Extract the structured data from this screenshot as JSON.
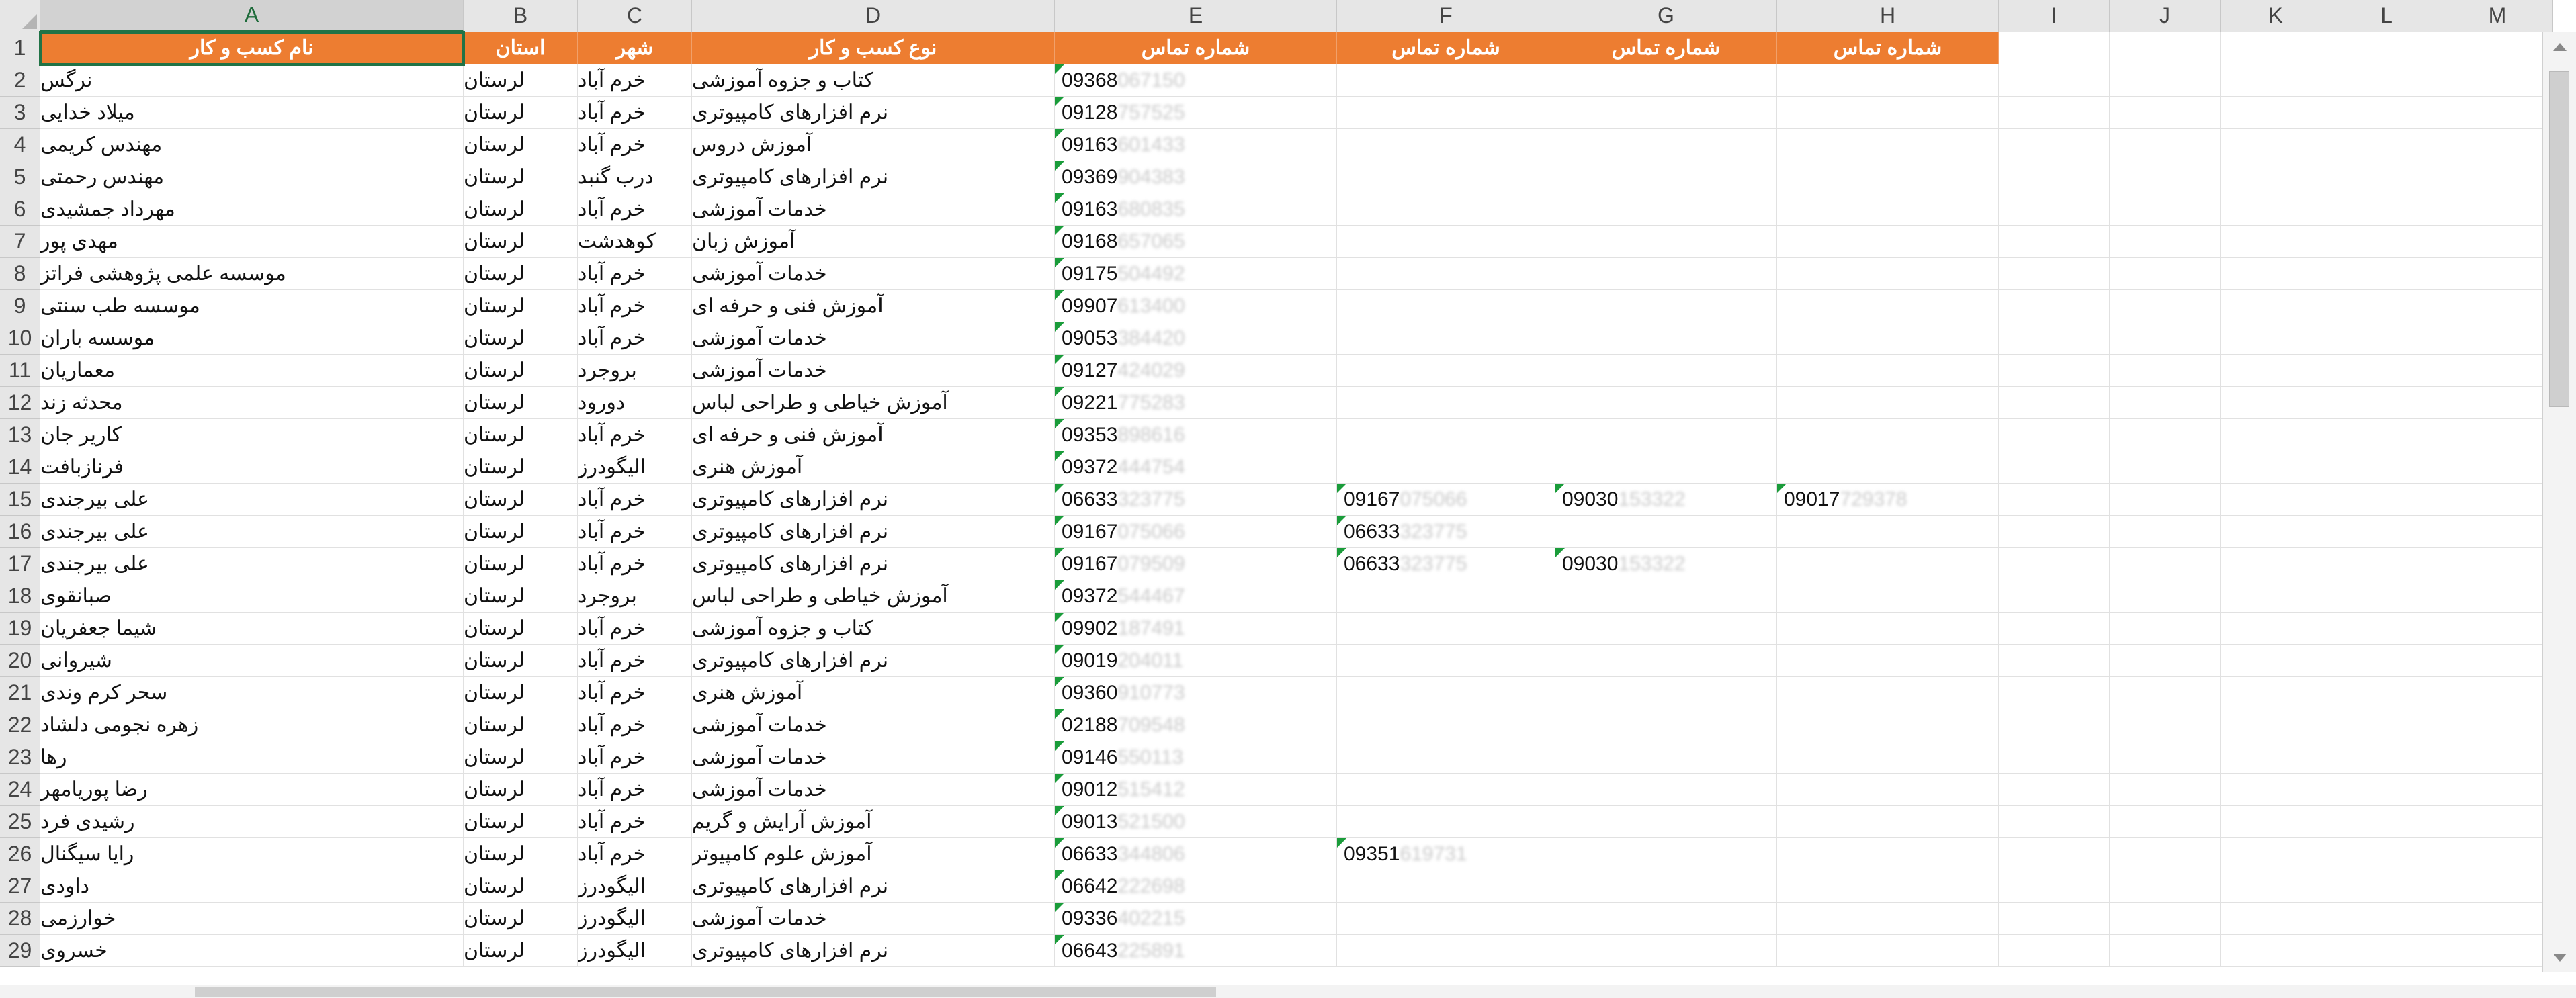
{
  "spreadsheet": {
    "selected_column": "A",
    "selected_row": "1",
    "columns": [
      {
        "letter": "A"
      },
      {
        "letter": "B"
      },
      {
        "letter": "C"
      },
      {
        "letter": "D"
      },
      {
        "letter": "E"
      },
      {
        "letter": "F"
      },
      {
        "letter": "G"
      },
      {
        "letter": "H"
      },
      {
        "letter": "I"
      },
      {
        "letter": "J"
      },
      {
        "letter": "K"
      },
      {
        "letter": "L"
      },
      {
        "letter": "M"
      }
    ],
    "header_row": {
      "A": "نام کسب و کار",
      "B": "استان",
      "C": "شهر",
      "D": "نوع کسب و کار",
      "E": "شماره تماس",
      "F": "شماره تماس",
      "G": "شماره تماس",
      "H": "شماره تماس"
    },
    "header_color": "#ed7d31",
    "rows": [
      {
        "n": "2",
        "A": "نرگس",
        "B": "لرستان",
        "C": "خرم آباد",
        "D": "کتاب و جزوه آموزشی",
        "E": "09368",
        "E_hidden": "067150"
      },
      {
        "n": "3",
        "A": "میلاد خدایی",
        "B": "لرستان",
        "C": "خرم آباد",
        "D": "نرم افزارهای کامپیوتری",
        "E": "09128",
        "E_hidden": "757525"
      },
      {
        "n": "4",
        "A": "مهندس کریمی",
        "B": "لرستان",
        "C": "خرم آباد",
        "D": "آموزش دروس",
        "E": "09163",
        "E_hidden": "601433"
      },
      {
        "n": "5",
        "A": "مهندس رحمتی",
        "B": "لرستان",
        "C": "درب گنبد",
        "D": "نرم افزارهای کامپیوتری",
        "E": "09369",
        "E_hidden": "904383"
      },
      {
        "n": "6",
        "A": "مهرداد جمشیدی",
        "B": "لرستان",
        "C": "خرم آباد",
        "D": "خدمات آموزشی",
        "E": "09163",
        "E_hidden": "680835"
      },
      {
        "n": "7",
        "A": "مهدی پور",
        "B": "لرستان",
        "C": "کوهدشت",
        "D": "آموزش زبان",
        "E": "09168",
        "E_hidden": "657065"
      },
      {
        "n": "8",
        "A": "موسسه علمی پژوهشی فراتز",
        "B": "لرستان",
        "C": "خرم آباد",
        "D": "خدمات آموزشی",
        "E": "09175",
        "E_hidden": "504492"
      },
      {
        "n": "9",
        "A": "موسسه طب سنتی",
        "B": "لرستان",
        "C": "خرم آباد",
        "D": "آموزش فنی و حرفه ای",
        "E": "09907",
        "E_hidden": "613400"
      },
      {
        "n": "10",
        "A": "موسسه باران",
        "B": "لرستان",
        "C": "خرم آباد",
        "D": "خدمات آموزشی",
        "E": "09053",
        "E_hidden": "384420"
      },
      {
        "n": "11",
        "A": "معماریان",
        "B": "لرستان",
        "C": "بروجرد",
        "D": "خدمات آموزشی",
        "E": "09127",
        "E_hidden": "424029"
      },
      {
        "n": "12",
        "A": "محدثه زند",
        "B": "لرستان",
        "C": "دورود",
        "D": "آموزش خیاطی و طراحی لباس",
        "E": "09221",
        "E_hidden": "775283"
      },
      {
        "n": "13",
        "A": "کاریر جان",
        "B": "لرستان",
        "C": "خرم آباد",
        "D": "آموزش فنی و حرفه ای",
        "E": "09353",
        "E_hidden": "898616"
      },
      {
        "n": "14",
        "A": "فرنازبافت",
        "B": "لرستان",
        "C": "الیگودرز",
        "D": "آموزش هنری",
        "E": "09372",
        "E_hidden": "444754"
      },
      {
        "n": "15",
        "A": "علی بیرجندی",
        "B": "لرستان",
        "C": "خرم آباد",
        "D": "نرم افزارهای کامپیوتری",
        "E": "06633",
        "E_hidden": "323775",
        "F": "09167",
        "F_hidden": "075066",
        "G": "09030",
        "G_hidden": "153322",
        "H": "09017",
        "H_hidden": "729378"
      },
      {
        "n": "16",
        "A": "علی بیرجندی",
        "B": "لرستان",
        "C": "خرم آباد",
        "D": "نرم افزارهای کامپیوتری",
        "E": "09167",
        "E_hidden": "075066",
        "F": "06633",
        "F_hidden": "323775"
      },
      {
        "n": "17",
        "A": "علی بیرجندی",
        "B": "لرستان",
        "C": "خرم آباد",
        "D": "نرم افزارهای کامپیوتری",
        "E": "09167",
        "E_hidden": "079509",
        "F": "06633",
        "F_hidden": "323775",
        "G": "09030",
        "G_hidden": "153322"
      },
      {
        "n": "18",
        "A": "صبانقوی",
        "B": "لرستان",
        "C": "بروجرد",
        "D": "آموزش خیاطی و طراحی لباس",
        "E": "09372",
        "E_hidden": "544467"
      },
      {
        "n": "19",
        "A": "شیما جعفریان",
        "B": "لرستان",
        "C": "خرم آباد",
        "D": "کتاب و جزوه آموزشی",
        "E": "09902",
        "E_hidden": "187491"
      },
      {
        "n": "20",
        "A": "شیروانی",
        "B": "لرستان",
        "C": "خرم آباد",
        "D": "نرم افزارهای کامپیوتری",
        "E": "09019",
        "E_hidden": "204011"
      },
      {
        "n": "21",
        "A": "سحر کرم وندی",
        "B": "لرستان",
        "C": "خرم آباد",
        "D": "آموزش هنری",
        "E": "09360",
        "E_hidden": "910773"
      },
      {
        "n": "22",
        "A": "زهره نجومی دلشاد",
        "B": "لرستان",
        "C": "خرم آباد",
        "D": "خدمات آموزشی",
        "E": "02188",
        "E_hidden": "709548"
      },
      {
        "n": "23",
        "A": "رها",
        "B": "لرستان",
        "C": "خرم آباد",
        "D": "خدمات آموزشی",
        "E": "09146",
        "E_hidden": "550113"
      },
      {
        "n": "24",
        "A": "رضا پوریامهر",
        "B": "لرستان",
        "C": "خرم آباد",
        "D": "خدمات آموزشی",
        "E": "09012",
        "E_hidden": "515412"
      },
      {
        "n": "25",
        "A": "رشیدی فرد",
        "B": "لرستان",
        "C": "خرم آباد",
        "D": "آموزش آرایش و گریم",
        "E": "09013",
        "E_hidden": "521500"
      },
      {
        "n": "26",
        "A": "رایا سیگنال",
        "B": "لرستان",
        "C": "خرم آباد",
        "D": "آموزش علوم کامپیوتر",
        "E": "06633",
        "E_hidden": "344806",
        "F": "09351",
        "F_hidden": "619731"
      },
      {
        "n": "27",
        "A": "داودی",
        "B": "لرستان",
        "C": "الیگودرز",
        "D": "نرم افزارهای کامپیوتری",
        "E": "06642",
        "E_hidden": "222698"
      },
      {
        "n": "28",
        "A": "خوارزمی",
        "B": "لرستان",
        "C": "الیگودرز",
        "D": "خدمات آموزشی",
        "E": "09336",
        "E_hidden": "402215"
      },
      {
        "n": "29",
        "A": "خسروی",
        "B": "لرستان",
        "C": "الیگودرز",
        "D": "نرم افزارهای کامپیوتری",
        "E": "06643",
        "E_hidden": "225891"
      }
    ]
  }
}
